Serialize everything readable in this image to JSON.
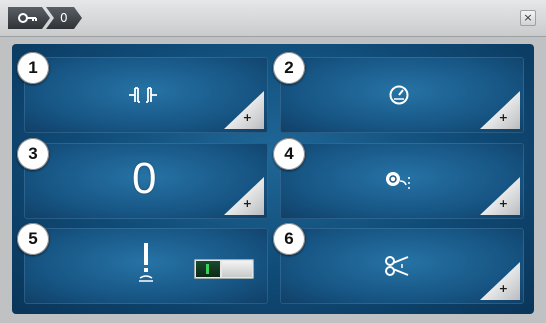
{
  "header": {
    "crumbs": [
      {
        "label": "",
        "icon": "key-icon"
      },
      {
        "label": "0"
      }
    ],
    "close_label": "×"
  },
  "tiles": [
    {
      "number": "1",
      "icon": "stitch-length-icon"
    },
    {
      "number": "2",
      "icon": "speed-gauge-icon"
    },
    {
      "number": "3",
      "icon": "value-display",
      "value": "0"
    },
    {
      "number": "4",
      "icon": "thread-tension-icon"
    },
    {
      "number": "5",
      "icon": "needle-stop-icon",
      "toggle": "on"
    },
    {
      "number": "6",
      "icon": "scissors-icon"
    }
  ],
  "colors": {
    "panel": "#0f4a76",
    "tile": "#175685",
    "toggle_on": "#39d25b"
  }
}
